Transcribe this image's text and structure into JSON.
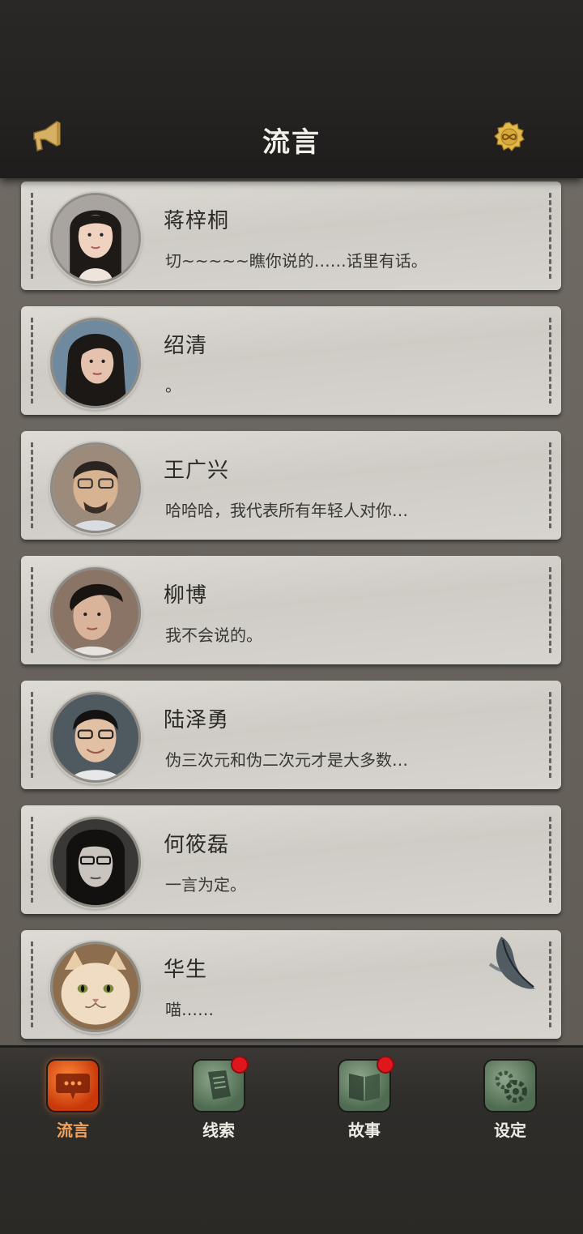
{
  "header": {
    "title": "流言",
    "left_icon": "megaphone-icon",
    "right_icon": "infinity-coin-icon"
  },
  "contacts": [
    {
      "name": "蒋梓桐",
      "message": "切~~~~~瞧你说的……话里有话。",
      "avatar": "woman-long-hair"
    },
    {
      "name": "绍清",
      "message": "。",
      "avatar": "woman-dark-hair"
    },
    {
      "name": "王广兴",
      "message": "哈哈哈，我代表所有年轻人对你…",
      "avatar": "man-glasses-beard"
    },
    {
      "name": "柳博",
      "message": "我不会说的。",
      "avatar": "man-side-part"
    },
    {
      "name": "陆泽勇",
      "message": "伪三次元和伪二次元才是大多数…",
      "avatar": "man-glasses-smile"
    },
    {
      "name": "何筱磊",
      "message": "一言为定。",
      "avatar": "man-glasses-long-hair"
    },
    {
      "name": "华生",
      "message": "喵……",
      "avatar": "cat"
    }
  ],
  "tabs": [
    {
      "label": "流言",
      "icon": "chat-bubble-icon",
      "active": true,
      "badge": false
    },
    {
      "label": "线索",
      "icon": "notes-icon",
      "active": false,
      "badge": true
    },
    {
      "label": "故事",
      "icon": "book-icon",
      "active": false,
      "badge": true
    },
    {
      "label": "设定",
      "icon": "gear-icon",
      "active": false,
      "badge": false
    }
  ],
  "colors": {
    "active_tab": "#e0531a",
    "badge": "#e0161d",
    "card": "#d6d3ce"
  }
}
